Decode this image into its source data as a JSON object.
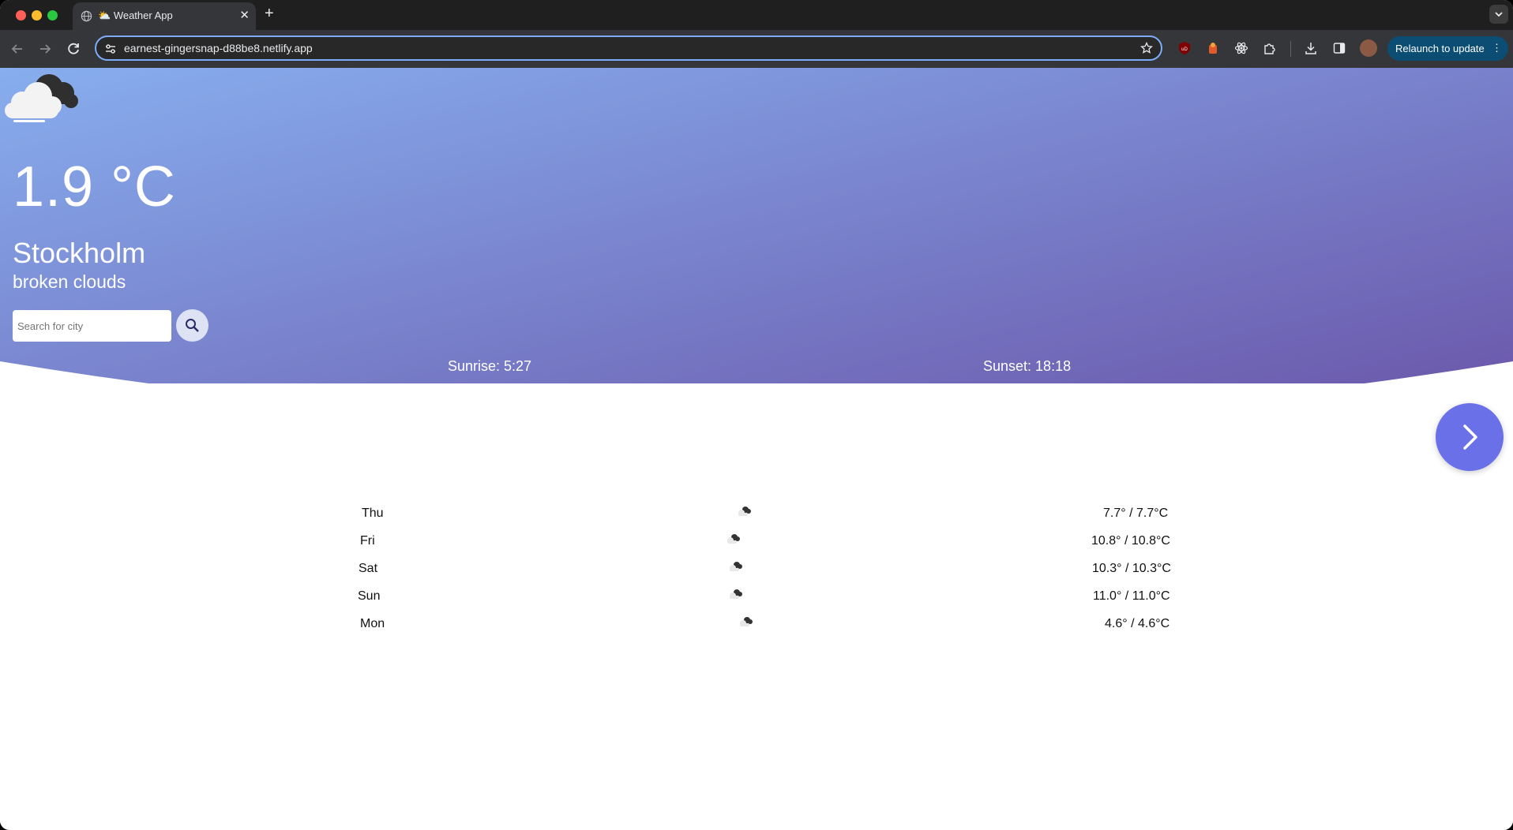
{
  "browser": {
    "tab_title": "Weather App",
    "url": "earnest-gingersnap-d88be8.netlify.app",
    "relaunch_label": "Relaunch to update"
  },
  "weather": {
    "temperature": "1.9 °C",
    "city": "Stockholm",
    "description": "broken clouds",
    "search_placeholder": "Search for city",
    "sunrise": "Sunrise: 5:27",
    "sunset": "Sunset: 18:18",
    "condition_icon": "broken-clouds-icon"
  },
  "forecast": [
    {
      "day": "Thu",
      "temp": "7.7° / 7.7°C",
      "icon": "broken-clouds-icon"
    },
    {
      "day": "Fri",
      "temp": "10.8° / 10.8°C",
      "icon": "broken-clouds-icon"
    },
    {
      "day": "Sat",
      "temp": "10.3° / 10.3°C",
      "icon": "broken-clouds-icon"
    },
    {
      "day": "Sun",
      "temp": "11.0° / 11.0°C",
      "icon": "broken-clouds-icon"
    },
    {
      "day": "Mon",
      "temp": "4.6° / 4.6°C",
      "icon": "broken-clouds-icon"
    }
  ],
  "colors": {
    "gradient_start": "#87aeee",
    "gradient_end": "#6a54a8",
    "accent_button": "#6a71e8"
  }
}
